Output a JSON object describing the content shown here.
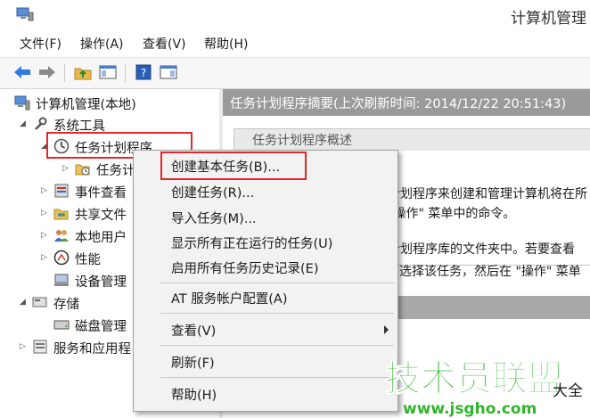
{
  "window": {
    "title": "计算机管理"
  },
  "menu": [
    "文件(F)",
    "操作(A)",
    "查看(V)",
    "帮助(H)"
  ],
  "tree": {
    "root": "计算机管理(本地)",
    "system_tools": "系统工具",
    "task_scheduler": "任务计划程序",
    "task_scheduler_lib": "任务计",
    "event_viewer": "事件查看",
    "shared_folders": "共享文件",
    "local_users": "本地用户",
    "performance": "性能",
    "device_manager": "设备管理",
    "storage": "存储",
    "disk_management": "磁盘管理",
    "services_apps": "服务和应用程"
  },
  "summary": {
    "header": "任务计划程序摘要(上次刷新时间: 2014/12/22 20:51:43)",
    "panel_title": "任务计划程序概述",
    "lines": [
      "计划程序来创建和管理计算机将在所",
      "\"操作\" 菜单中的命令。",
      "计划程序库的文件夹中。若要查看",
      "中选择该任务，然后在 \"操作\" 菜单"
    ]
  },
  "context_menu": {
    "create_basic": "创建基本任务(B)...",
    "create_task": "创建任务(R)...",
    "import": "导入任务(M)...",
    "show_running": "显示所有正在运行的任务(U)",
    "enable_history": "启用所有任务历史记录(E)",
    "at_account": "AT 服务帐户配置(A)",
    "view": "查看(V)",
    "refresh": "刷新(F)",
    "help": "帮助(H)"
  },
  "watermark": {
    "brand": "技术员联盟",
    "url": "www.jsgho.com",
    "corner": "大全"
  },
  "colors": {
    "highlight_red": "#e0282e",
    "watermark_green": "#2fb52a",
    "summary_bar": "#9a9a9a"
  }
}
